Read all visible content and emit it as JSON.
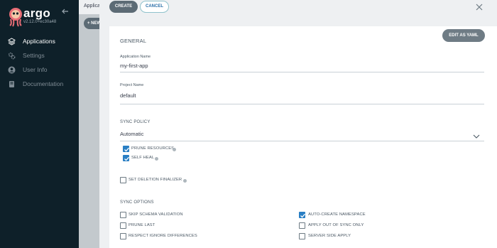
{
  "sidebar": {
    "logo_text": "argo",
    "version": "v2.12.0+ec30a48",
    "items": [
      {
        "label": "Applications",
        "icon": "layers-icon",
        "active": true
      },
      {
        "label": "Settings",
        "icon": "gears-icon",
        "active": false
      },
      {
        "label": "User Info",
        "icon": "user-icon",
        "active": false
      },
      {
        "label": "Documentation",
        "icon": "book-icon",
        "active": false
      }
    ]
  },
  "background": {
    "title": "Applications",
    "new_app_label": "+ NEW APP"
  },
  "panel": {
    "create_label": "CREATE",
    "cancel_label": "CANCEL",
    "edit_yaml_label": "EDIT AS YAML",
    "general_title": "GENERAL",
    "app_name_label": "Application Name",
    "app_name_value": "my-first-app",
    "project_label": "Project Name",
    "project_value": "default",
    "sync_policy_title": "SYNC POLICY",
    "sync_policy_value": "Automatic",
    "prune_label": "PRUNE RESOURCES",
    "self_heal_label": "SELF HEAL",
    "finalizer_label": "SET DELETION FINALIZER",
    "sync_options_title": "SYNC OPTIONS",
    "options": {
      "skip_schema": "SKIP SCHEMA VALIDATION",
      "prune_last": "PRUNE LAST",
      "respect_ignore": "RESPECT IGNORE DIFFERENCES",
      "auto_create_ns": "AUTO-CREATE NAMESPACE",
      "apply_oos": "APPLY OUT OF SYNC ONLY",
      "server_side": "SERVER SIDE APPLY"
    }
  },
  "colors": {
    "sidebar_bg": "#0e2029",
    "accent_checkbox": "#2a7fc4",
    "button_dark": "#5c6b75"
  }
}
